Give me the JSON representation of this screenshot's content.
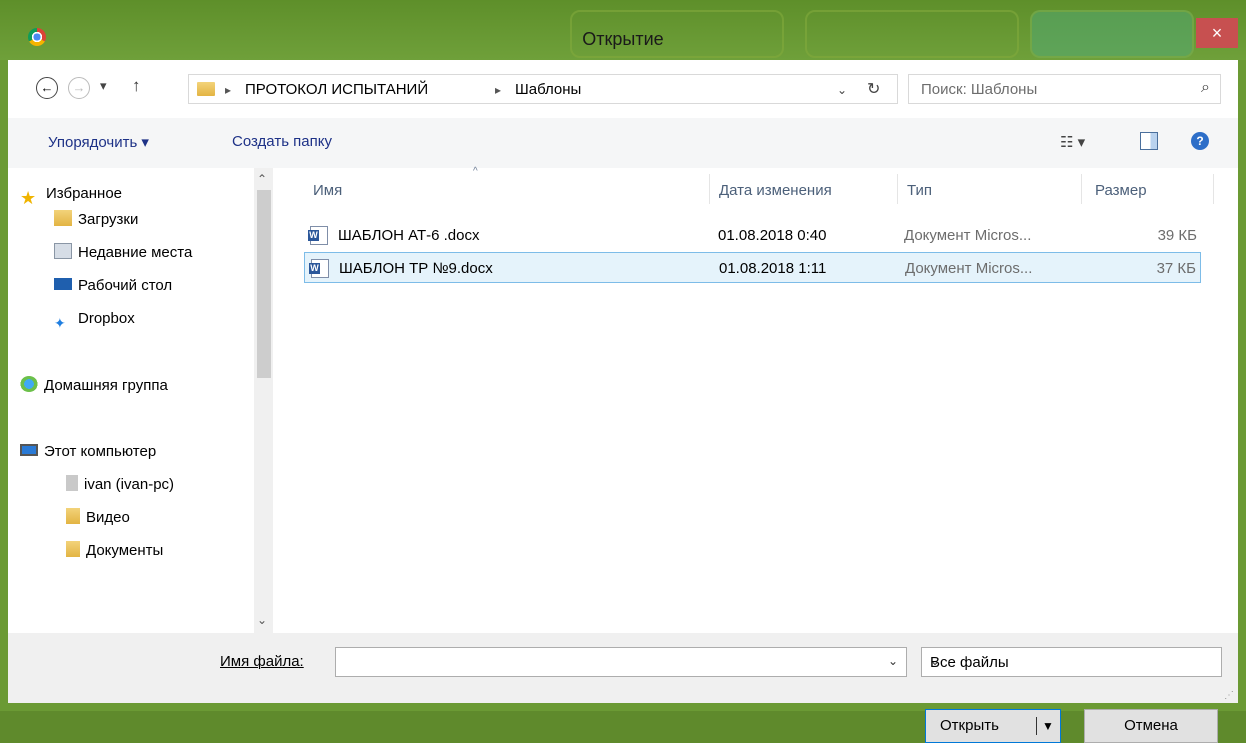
{
  "window": {
    "title": "Открытие",
    "close_label": "×"
  },
  "nav": {
    "back_label": "←",
    "forward_label": "→",
    "recent_label": "▾",
    "up_label": "↑",
    "breadcrumb": [
      "ПРОТОКОЛ ИСПЫТАНИЙ",
      "Шаблоны"
    ],
    "crumb_sep": "▸",
    "refresh_label": "↻",
    "search_placeholder": "Поиск: Шаблоны",
    "search_icon": "⌕"
  },
  "toolbar": {
    "organize_label": "Упорядочить ▾",
    "new_folder_label": "Создать папку",
    "view_icon": "☷ ▾",
    "help_icon": "?"
  },
  "sidebar": {
    "favorites": "Избранное",
    "downloads": "Загрузки",
    "recent": "Недавние места",
    "desktop": "Рабочий стол",
    "dropbox": "Dropbox",
    "homegroup": "Домашняя группа",
    "this_pc": "Этот компьютер",
    "network": "ivan (ivan-pc)",
    "video": "Видео",
    "documents": "Документы"
  },
  "columns": {
    "name": "Имя",
    "date": "Дата изменения",
    "type": "Тип",
    "size": "Размер"
  },
  "files": [
    {
      "name": "ШАБЛОН АТ-6 .docx",
      "date": "01.08.2018 0:40",
      "type": "Документ Micros...",
      "size": "39 КБ"
    },
    {
      "name": "ШАБЛОН ТР №9.docx",
      "date": "01.08.2018 1:11",
      "type": "Документ Micros...",
      "size": "37 КБ"
    }
  ],
  "bottom": {
    "filename_label": "Имя файла:",
    "filename_value": "",
    "filter_value": "Все файлы",
    "open_label": "Открыть",
    "cancel_label": "Отмена"
  }
}
